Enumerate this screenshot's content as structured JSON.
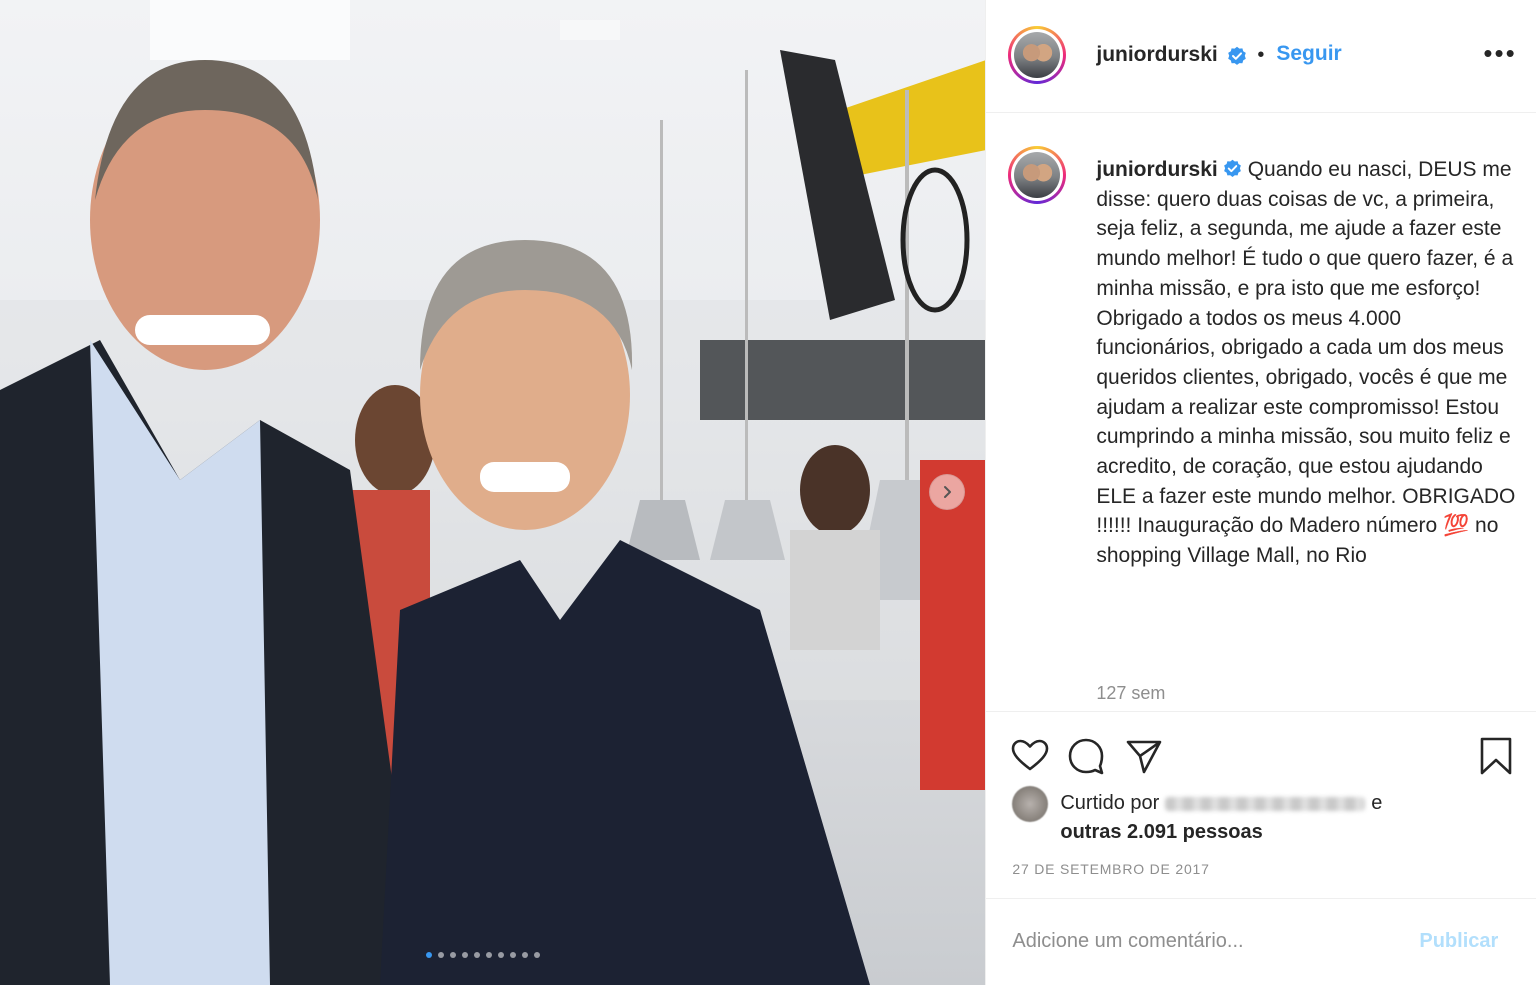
{
  "header": {
    "username": "juniordurski",
    "separator": "•",
    "follow_label": "Seguir",
    "more_label": "•••"
  },
  "caption": {
    "username": "juniordurski",
    "text": "Quando eu nasci, DEUS me disse: quero duas coisas de vc, a primeira, seja feliz, a segunda, me ajude a fazer este mundo melhor! É tudo o que quero fazer, é a minha missão, e pra isto que me esforço! Obrigado a todos os meus 4.000 funcionários, obrigado a cada um dos meus queridos clientes, obrigado, vocês é que me ajudam a realizar este compromisso! Estou cumprindo a minha missão, sou muito feliz e acredito, de coração, que estou ajudando ELE a fazer este mundo melhor. OBRIGADO !!!!!! Inauguração do Madero número 💯 no shopping Village Mall, no Rio",
    "time_ago": "127 sem"
  },
  "likes": {
    "prefix": "Curtido por",
    "suffix": "e",
    "others": "outras 2.091 pessoas"
  },
  "date": "27 DE SETEMBRO DE 2017",
  "comment": {
    "placeholder": "Adicione um comentário...",
    "publish_label": "Publicar"
  },
  "carousel": {
    "total_slides": 10,
    "active_slide": 1
  },
  "colors": {
    "accent": "#3897f0",
    "publish_disabled": "#b2dffc",
    "muted": "#8e8e8e"
  },
  "icons": [
    "heart-icon",
    "comment-icon",
    "share-icon",
    "bookmark-icon",
    "verified-badge-icon",
    "chevron-right-icon"
  ]
}
